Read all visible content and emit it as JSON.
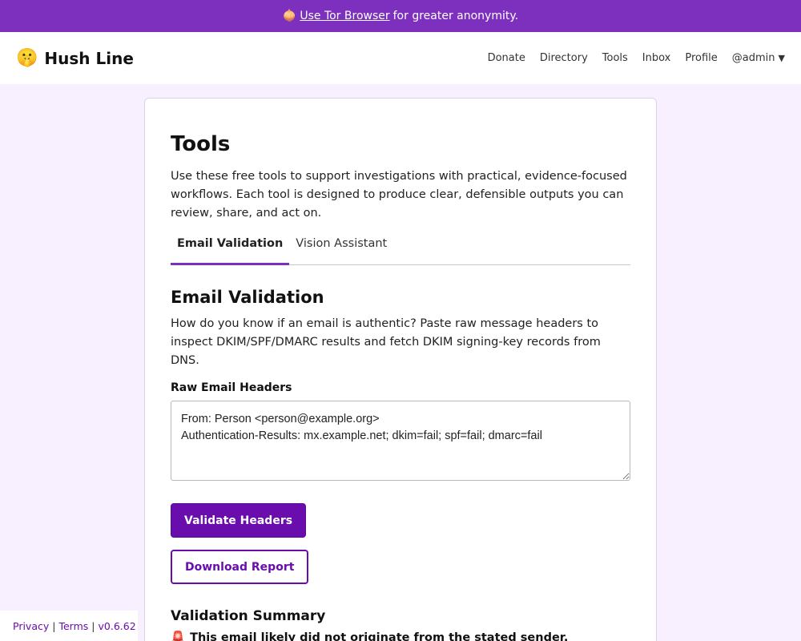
{
  "banner": {
    "icon": "onion-icon",
    "icon_glyph": "🧅",
    "link_text": "Use Tor Browser",
    "trailing_text": "for greater anonymity."
  },
  "header": {
    "brand_emoji": "🤫",
    "brand_name": "Hush Line",
    "nav": {
      "donate": "Donate",
      "directory": "Directory",
      "tools": "Tools",
      "inbox": "Inbox",
      "profile": "Profile",
      "user": "@admin",
      "caret": "▼"
    }
  },
  "main": {
    "title": "Tools",
    "intro": "Use these free tools to support investigations with practical, evidence-focused workflows. Each tool is designed to produce clear, defensible outputs you can review, share, and act on.",
    "tabs": [
      {
        "label": "Email Validation",
        "active": true
      },
      {
        "label": "Vision Assistant",
        "active": false
      }
    ],
    "section_title": "Email Validation",
    "section_desc": "How do you know if an email is authentic? Paste raw message headers to inspect DKIM/SPF/DMARC results and fetch DKIM signing-key records from DNS.",
    "field_label": "Raw Email Headers",
    "headers_value": "From: Person <person@example.org>\nAuthentication-Results: mx.example.net; dkim=fail; spf=fail; dmarc=fail",
    "validate_button": "Validate Headers",
    "download_button": "Download Report",
    "summary_title": "Validation Summary",
    "summary_icon": "🚨",
    "summary_text": "This email likely did not originate from the stated sender."
  },
  "footer": {
    "privacy": "Privacy",
    "terms": "Terms",
    "separator": "|",
    "version": "v0.6.62"
  },
  "colors": {
    "accent": "#6a0dad",
    "banner": "#7d2fbe",
    "page_bg": "#f8efff"
  }
}
